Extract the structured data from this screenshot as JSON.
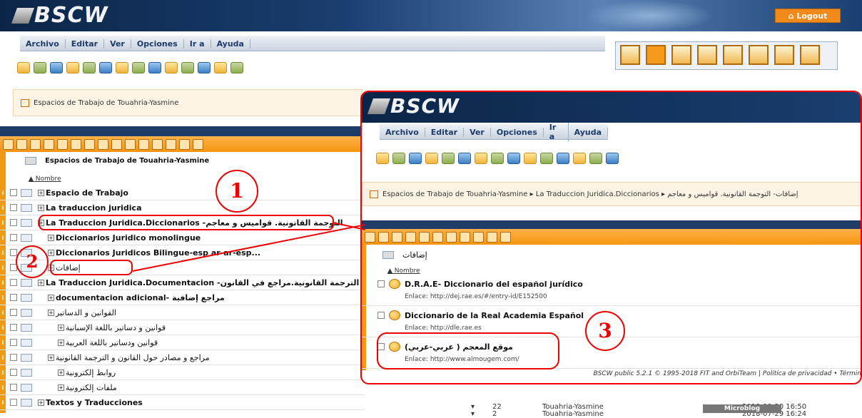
{
  "app": {
    "logo": "BSCW",
    "logout": "Logout"
  },
  "menu": [
    "Archivo",
    "Editar",
    "Ver",
    "Opciones",
    "Ir a",
    "Ayuda"
  ],
  "breadcrumb_left": "Espacios de Trabajo de Touahria-Yasmine",
  "left": {
    "title": "Espacios de Trabajo de Touahria-Yasmine",
    "sort": "Nombre",
    "rows": [
      {
        "label": "Espacio de Trabajo",
        "indent": 0,
        "bold": true
      },
      {
        "label": "La traduccion juridica",
        "indent": 0,
        "bold": true
      },
      {
        "label": "La Traduccion Juridica.Diccionarios -التوجمة القانونية. قواميس و معاجم",
        "indent": 0,
        "bold": true
      },
      {
        "label": "Diccionarios Juridico monolingue",
        "indent": 1,
        "bold": true
      },
      {
        "label": "Diccionarios Juridicos Bilingue-esp ar-ar-esp...",
        "indent": 1,
        "bold": true
      },
      {
        "label": "إضافات",
        "indent": 1,
        "bold": false
      },
      {
        "label": "La Traduccion Juridica.Documentacion -الترجمة القانونية.مراجع في القانون",
        "indent": 0,
        "bold": true
      },
      {
        "label": "documentacion adicional- مراجع إضافية",
        "indent": 1,
        "bold": true
      },
      {
        "label": "القوانين و الدساتير",
        "indent": 1,
        "bold": false
      },
      {
        "label": "قوانين و دساتير باللغة الإسبانية",
        "indent": 2,
        "bold": false
      },
      {
        "label": "قوانين ودساتير باللغة العربية",
        "indent": 2,
        "bold": false
      },
      {
        "label": "مراجع و مصادر حول القانون و الترجمة القانونية",
        "indent": 1,
        "bold": false
      },
      {
        "label": "روابط إلكترونية",
        "indent": 2,
        "bold": false
      },
      {
        "label": "ملفات إلكترونية",
        "indent": 2,
        "bold": false
      },
      {
        "label": "Textos y Traducciones",
        "indent": 0,
        "bold": true
      }
    ]
  },
  "right": {
    "logo": "BSCW",
    "breadcrumb": "Espacios de Trabajo de Touahria-Yasmine ▸ La Traduccion Juridica.Diccionarios ▸ إضافات- التوجمة القانونية. قواميس و معاجم",
    "folder_title": "إضافات",
    "sort": "Nombre",
    "items": [
      {
        "title": "D.R.A.E- Diccionario del español jurídico",
        "link_label": "Enlace:",
        "url": "http://dej.rae.es/#/entry-id/E152500"
      },
      {
        "title": "Diccionario de la Real Academia Español",
        "link_label": "Enlace:",
        "url": "http://dle.rae.es"
      },
      {
        "title": "(موقع المعجم ( عربي-عربي",
        "link_label": "Enlace:",
        "url": "http://www.almougem.com/"
      }
    ],
    "footer": "BSCW public 5.2.1 © 1995-2018 FIT and OrbiTeam | Política de privacidad • Términ"
  },
  "bottom_rows": [
    {
      "count": "22",
      "user": "Touahria-Yasmine",
      "date": "2018-08-20 16:50"
    },
    {
      "count": "2",
      "user": "Touahria-Yasmine",
      "date": "2018-07-29 16:24"
    }
  ],
  "microblog": "Microblog",
  "markers": [
    "1",
    "2",
    "3"
  ]
}
